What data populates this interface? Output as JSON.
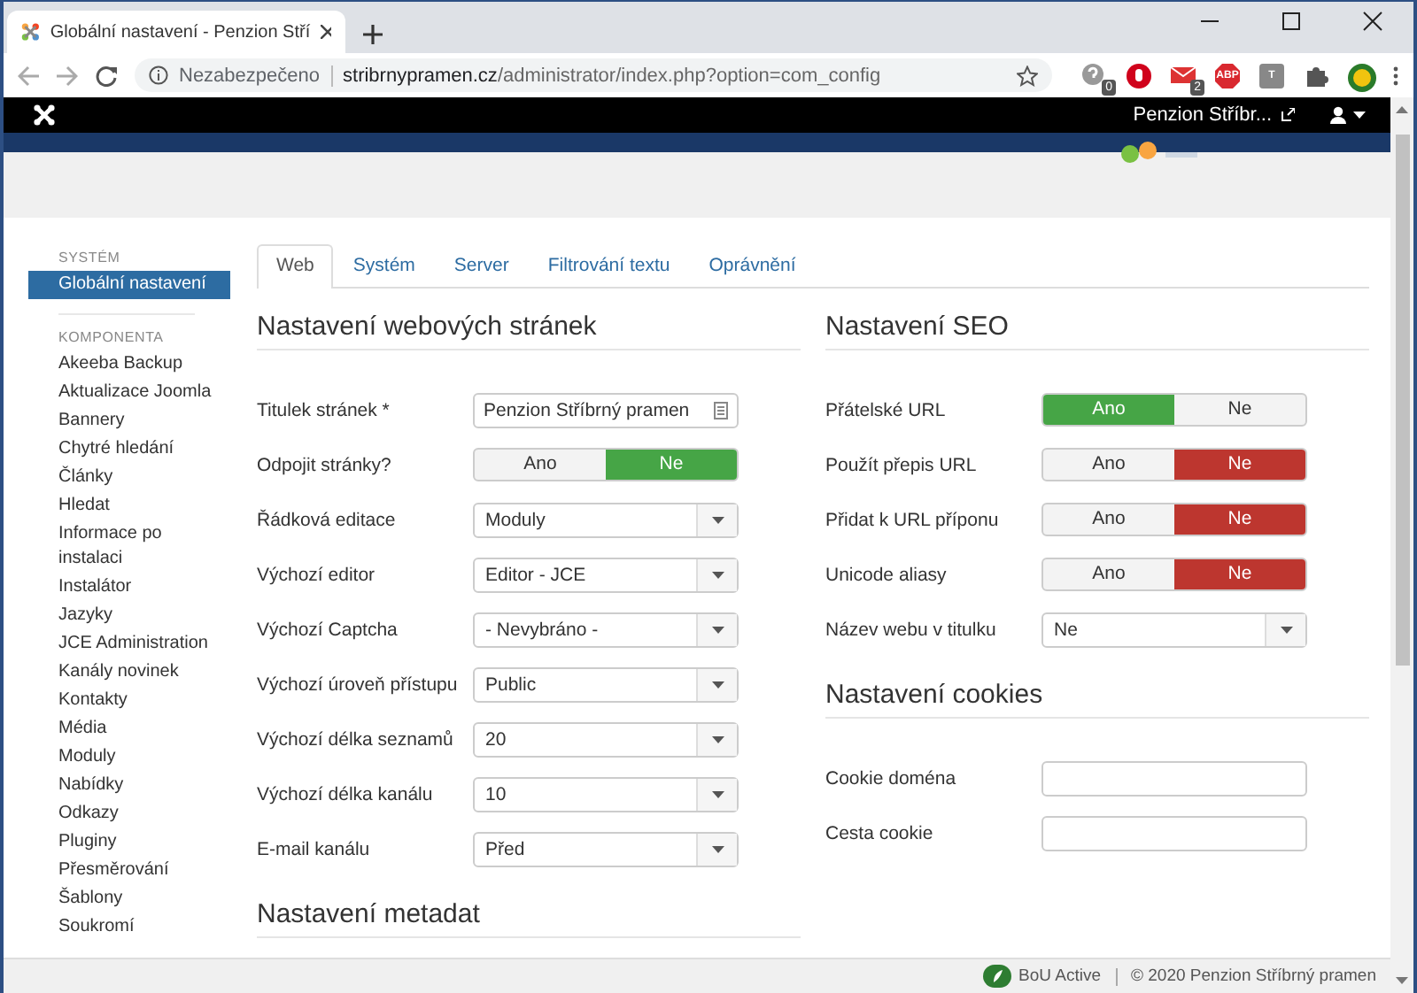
{
  "browser": {
    "tab_title": "Globální nastavení - Penzion Stří",
    "security": "Nezabezpečeno",
    "url_host": "stribrnypramen.cz",
    "url_path": "/administrator/index.php?option=com_config",
    "extensions": [
      {
        "kind": "help",
        "badge": "0"
      },
      {
        "kind": "stop"
      },
      {
        "kind": "mail",
        "badge": "2"
      },
      {
        "kind": "abp",
        "label": "ABP"
      },
      {
        "kind": "letter",
        "label": "T"
      },
      {
        "kind": "puzzle"
      },
      {
        "kind": "avatar"
      }
    ]
  },
  "top_bar": {
    "site_link": "Penzion Stříbr..."
  },
  "sidebar": {
    "sections": [
      {
        "heading": "SYSTÉM",
        "items": [
          {
            "label": "Globální nastavení",
            "selected": true
          }
        ]
      },
      {
        "heading": "KOMPONENTA",
        "items": [
          {
            "label": "Akeeba Backup",
            "selected": false
          },
          {
            "label": "Aktualizace Joomla",
            "selected": false
          },
          {
            "label": "Bannery",
            "selected": false
          },
          {
            "label": "Chytré hledání",
            "selected": false
          },
          {
            "label": "Články",
            "selected": false
          },
          {
            "label": "Hledat",
            "selected": false
          },
          {
            "label": "Informace po instalaci",
            "selected": false
          },
          {
            "label": "Instalátor",
            "selected": false
          },
          {
            "label": "Jazyky",
            "selected": false
          },
          {
            "label": "JCE Administration",
            "selected": false
          },
          {
            "label": "Kanály novinek",
            "selected": false
          },
          {
            "label": "Kontakty",
            "selected": false
          },
          {
            "label": "Média",
            "selected": false
          },
          {
            "label": "Moduly",
            "selected": false
          },
          {
            "label": "Nabídky",
            "selected": false
          },
          {
            "label": "Odkazy",
            "selected": false
          },
          {
            "label": "Pluginy",
            "selected": false
          },
          {
            "label": "Přesměrování",
            "selected": false
          },
          {
            "label": "Šablony",
            "selected": false
          },
          {
            "label": "Soukromí",
            "selected": false
          }
        ]
      }
    ]
  },
  "tabs": [
    {
      "label": "Web",
      "selected": true
    },
    {
      "label": "Systém",
      "selected": false
    },
    {
      "label": "Server",
      "selected": false
    },
    {
      "label": "Filtrování textu",
      "selected": false
    },
    {
      "label": "Oprávnění",
      "selected": false
    }
  ],
  "left": {
    "sections": [
      {
        "title": "Nastavení webových stránek",
        "fields": [
          {
            "label": "Titulek stránek *",
            "kind": "text",
            "value": "Penzion Stříbrný pramen"
          },
          {
            "label": "Odpojit stránky?",
            "kind": "toggle",
            "color": "#46a546",
            "options": [
              {
                "label": "Ano",
                "selected": false
              },
              {
                "label": "Ne",
                "selected": true
              }
            ]
          },
          {
            "label": "Řádková editace",
            "kind": "select",
            "value": "Moduly"
          },
          {
            "label": "Výchozí editor",
            "kind": "select",
            "value": "Editor - JCE"
          },
          {
            "label": "Výchozí Captcha",
            "kind": "select",
            "value": "- Nevybráno -"
          },
          {
            "label": "Výchozí úroveň přístupu",
            "kind": "select",
            "value": "Public"
          },
          {
            "label": "Výchozí délka seznamů",
            "kind": "select",
            "value": "20"
          },
          {
            "label": "Výchozí délka kanálu",
            "kind": "select",
            "value": "10"
          },
          {
            "label": "E-mail kanálu",
            "kind": "select",
            "value": "Před"
          }
        ]
      },
      {
        "title": "Nastavení metadat"
      }
    ]
  },
  "right": {
    "sections": [
      {
        "title": "Nastavení SEO",
        "fields": [
          {
            "label": "Přátelské URL",
            "kind": "toggle",
            "color": "#46a546",
            "options": [
              {
                "label": "Ano",
                "selected": true
              },
              {
                "label": "Ne",
                "selected": false
              }
            ]
          },
          {
            "label": "Použít přepis URL",
            "kind": "toggle",
            "color": "#bd362f",
            "options": [
              {
                "label": "Ano",
                "selected": false
              },
              {
                "label": "Ne",
                "selected": true
              }
            ]
          },
          {
            "label": "Přidat k URL příponu",
            "kind": "toggle",
            "color": "#bd362f",
            "options": [
              {
                "label": "Ano",
                "selected": false
              },
              {
                "label": "Ne",
                "selected": true
              }
            ]
          },
          {
            "label": "Unicode aliasy",
            "kind": "toggle",
            "color": "#bd362f",
            "options": [
              {
                "label": "Ano",
                "selected": false
              },
              {
                "label": "Ne",
                "selected": true
              }
            ]
          },
          {
            "label": "Název webu v titulku",
            "kind": "select",
            "value": "Ne"
          }
        ]
      },
      {
        "title": "Nastavení cookies",
        "fields": [
          {
            "label": "Cookie doména",
            "kind": "input"
          },
          {
            "label": "Cesta cookie",
            "kind": "input"
          }
        ]
      }
    ]
  },
  "footer": {
    "brand": "BoU Active",
    "copyright": "© 2020 Penzion Stříbrný pramen"
  }
}
